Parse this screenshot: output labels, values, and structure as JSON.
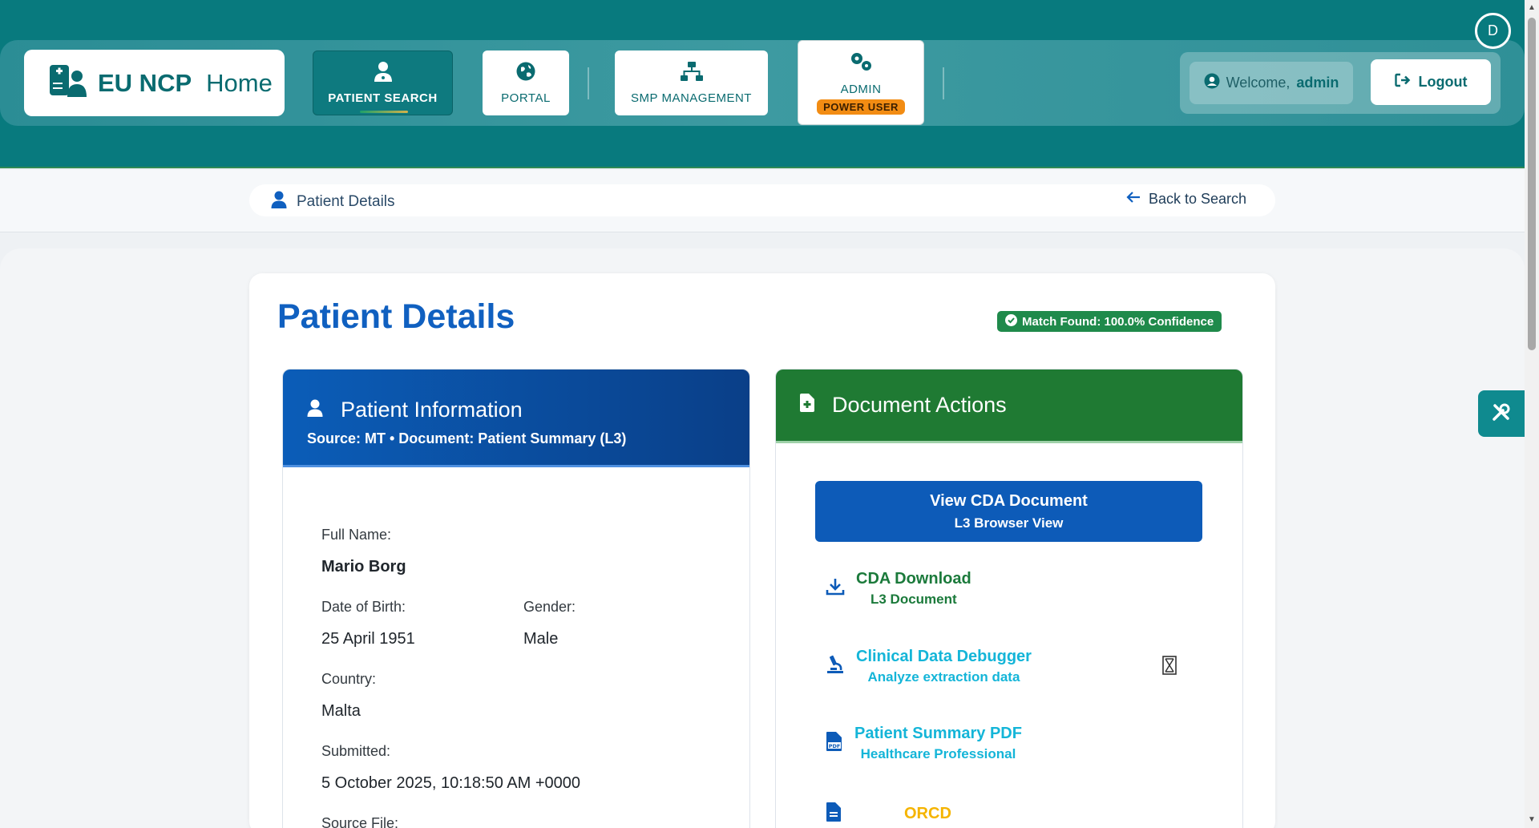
{
  "brand": {
    "title": "EU NCP",
    "home": "Home"
  },
  "nav": {
    "patient_search": "PATIENT SEARCH",
    "portal": "PORTAL",
    "smp": "SMP MANAGEMENT",
    "admin": "ADMIN",
    "admin_badge": "POWER USER"
  },
  "user": {
    "welcome_prefix": "Welcome,",
    "name": "admin",
    "logout": "Logout",
    "avatar_letter": "D"
  },
  "breadcrumb": {
    "label": "Patient Details",
    "back": "Back to Search"
  },
  "page": {
    "title": "Patient Details",
    "match": "Match Found: 100.0% Confidence"
  },
  "patient_panel": {
    "title": "Patient Information",
    "subtitle": "Source: MT • Document: Patient Summary (L3)",
    "full_name_label": "Full Name:",
    "full_name": "Mario Borg",
    "dob_label": "Date of Birth:",
    "dob": "25 April 1951",
    "gender_label": "Gender:",
    "gender": "Male",
    "country_label": "Country:",
    "country": "Malta",
    "submitted_label": "Submitted:",
    "submitted": "5 October 2025, 10:18:50 AM +0000",
    "source_file_label": "Source File:"
  },
  "document_panel": {
    "title": "Document Actions",
    "view_cda": {
      "title": "View CDA Document",
      "sub": "L3 Browser View"
    },
    "cda_download": {
      "title": "CDA Download",
      "sub": "L3 Document"
    },
    "debugger": {
      "title": "Clinical Data Debugger",
      "sub": "Analyze extraction data"
    },
    "pdf": {
      "title": "Patient Summary PDF",
      "sub": "Healthcare Professional"
    },
    "orcd": {
      "title": "ORCD"
    }
  },
  "colors": {
    "teal": "#087a7e",
    "blue": "#0d5bb8",
    "green": "#1f7a33",
    "cda_download": "#1b7a3b",
    "cyan_link": "#14b5d8",
    "orcd": "#f5b400"
  }
}
